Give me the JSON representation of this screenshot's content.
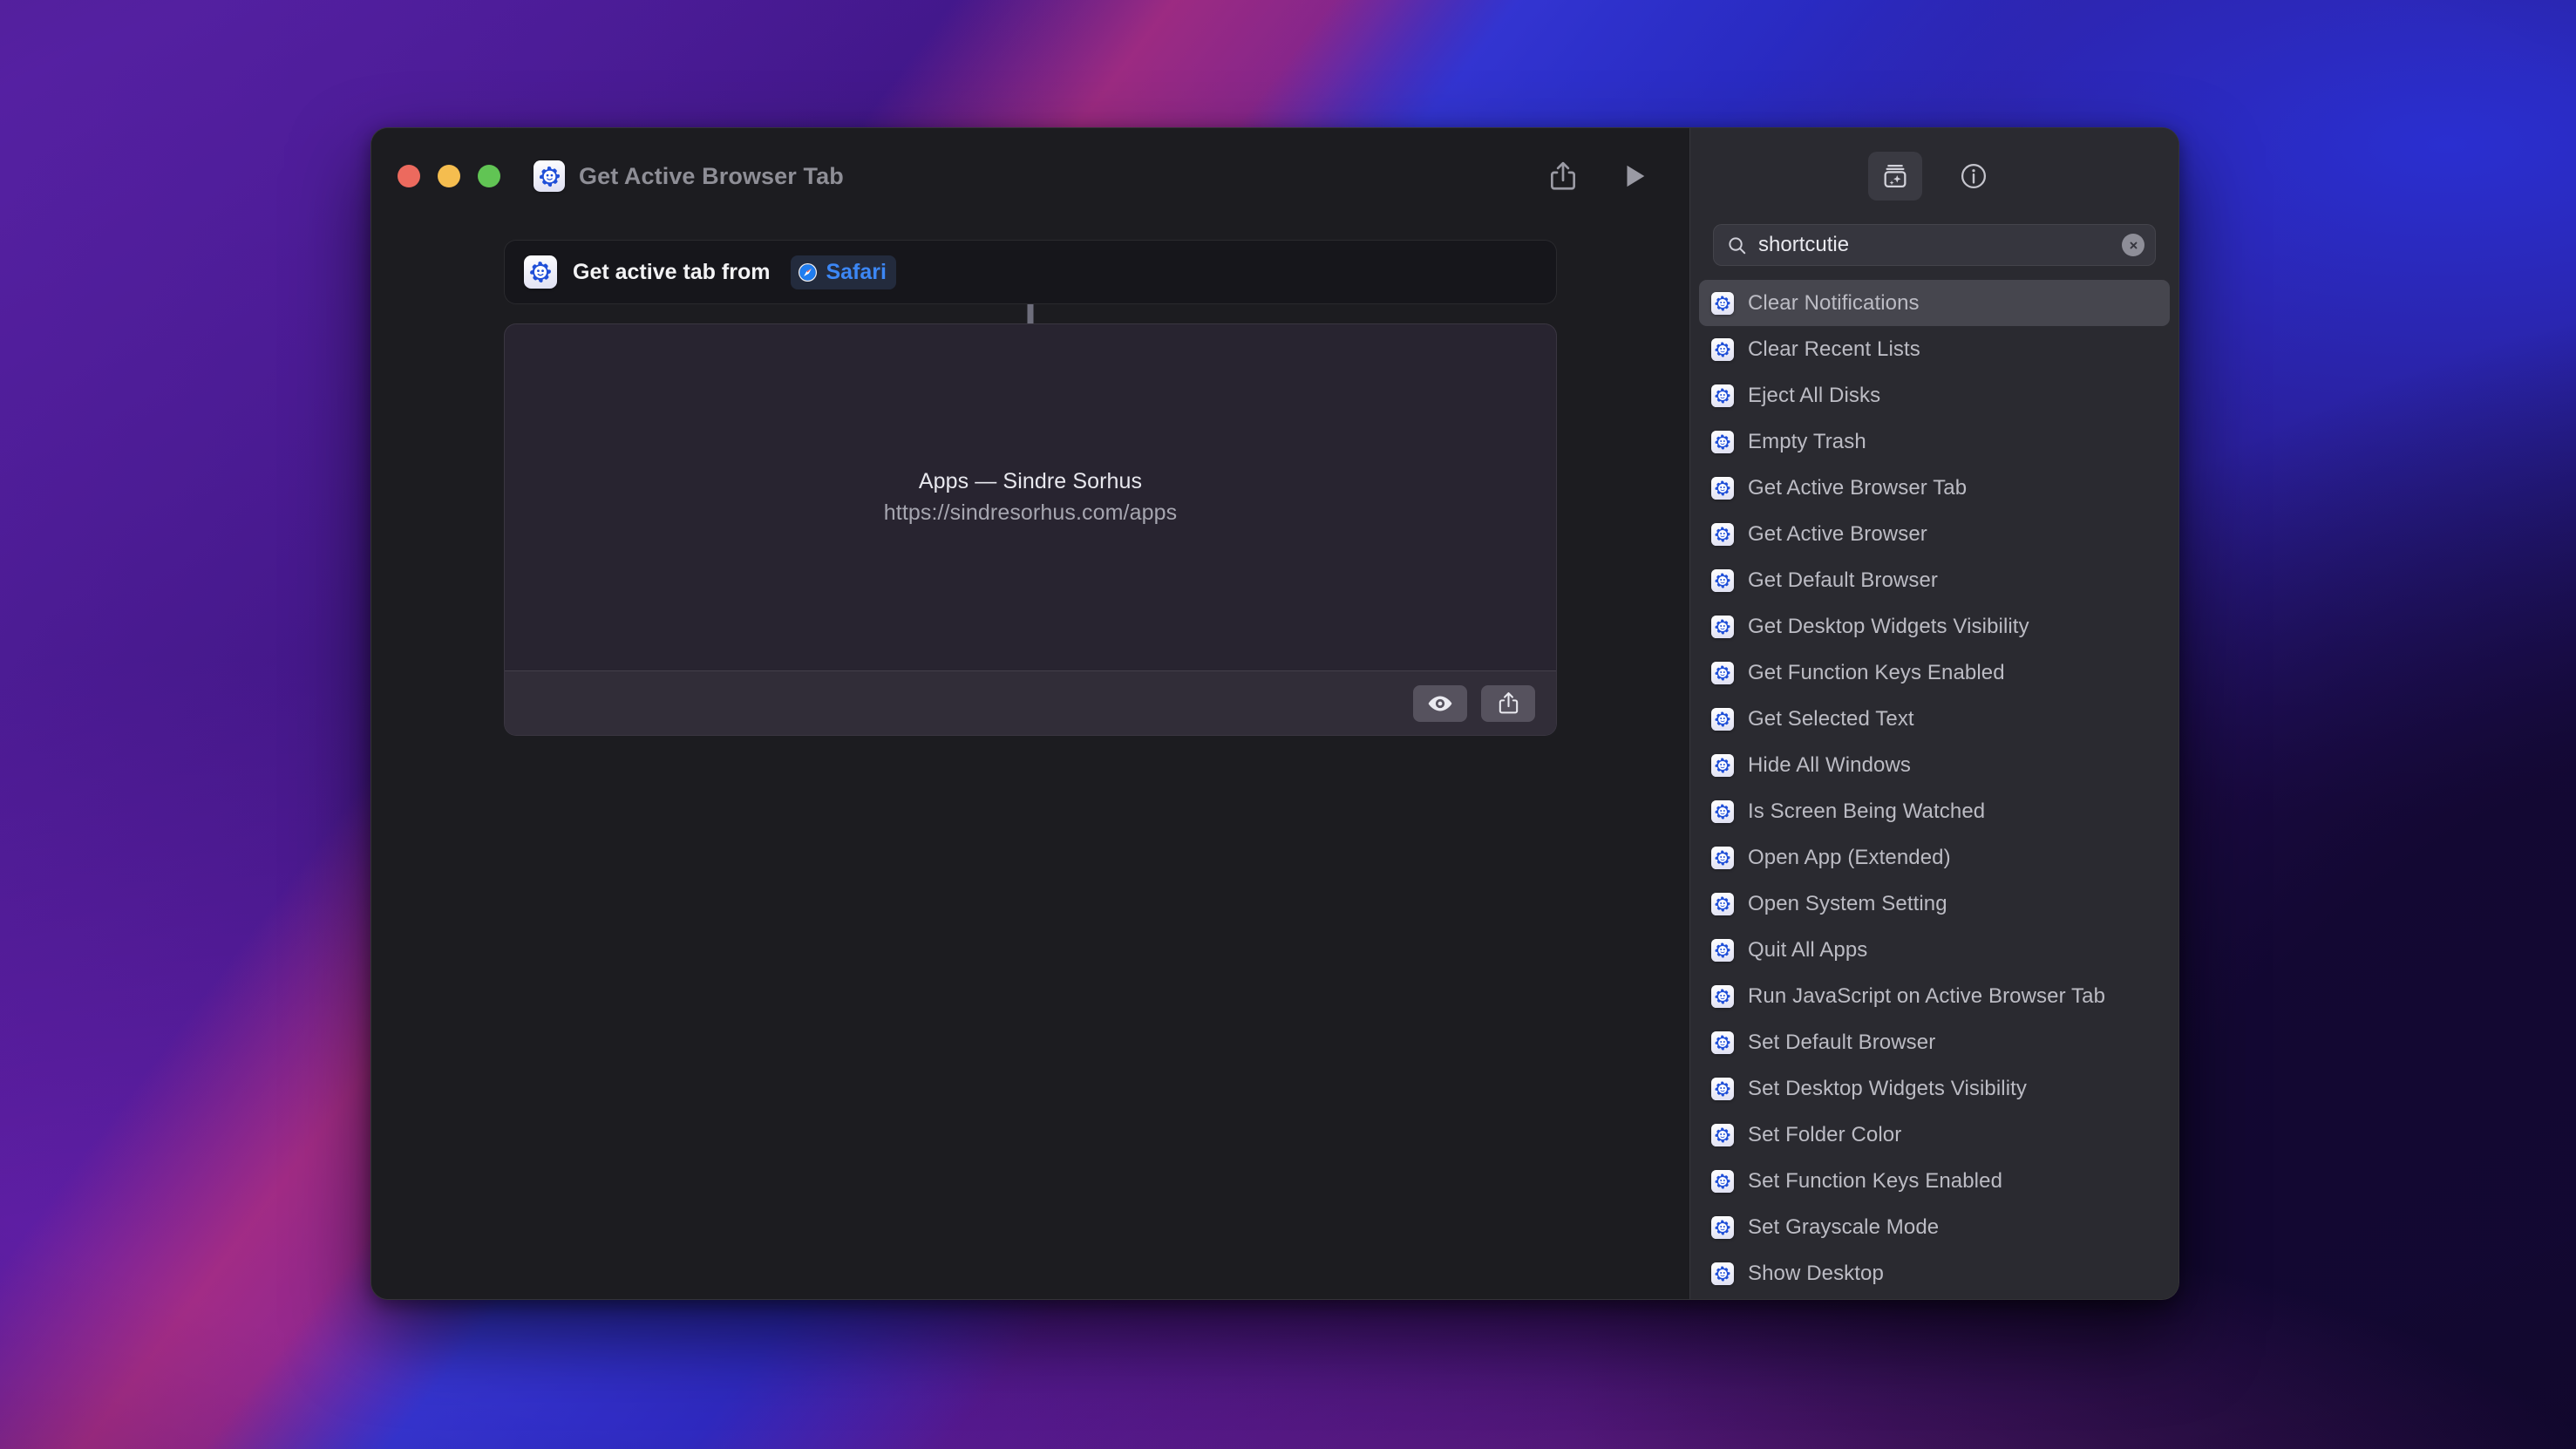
{
  "window": {
    "title": "Get Active Browser Tab",
    "app_icon": "shortcuts-gear-icon",
    "traffic_lights": {
      "close": "close-window-button",
      "minimize": "minimize-window-button",
      "maximize": "maximize-window-button",
      "close_color": "#EC6A5E",
      "minimize_color": "#F5BD4F",
      "maximize_color": "#61C454"
    },
    "toolbar": {
      "share_label": "Share",
      "run_label": "Run"
    }
  },
  "editor": {
    "action": {
      "text": "Get active tab from",
      "variable": {
        "label": "Safari",
        "icon": "safari-compass-icon",
        "color": "#3C87F5"
      }
    },
    "preview": {
      "title": "Apps — Sindre Sorhus",
      "url": "https://sindresorhus.com/apps",
      "footer": {
        "quicklook_label": "Quick Look",
        "share_label": "Share"
      }
    }
  },
  "sidebar": {
    "toolbar": {
      "library_label": "Action Library",
      "info_label": "Info"
    },
    "search": {
      "value": "shortcutie",
      "placeholder": "Search",
      "icon": "search-icon",
      "clear_label": "Clear search"
    },
    "items": [
      {
        "label": "Clear Notifications",
        "selected": true
      },
      {
        "label": "Clear Recent Lists",
        "selected": false
      },
      {
        "label": "Eject All Disks",
        "selected": false
      },
      {
        "label": "Empty Trash",
        "selected": false
      },
      {
        "label": "Get Active Browser Tab",
        "selected": false
      },
      {
        "label": "Get Active Browser",
        "selected": false
      },
      {
        "label": "Get Default Browser",
        "selected": false
      },
      {
        "label": "Get Desktop Widgets Visibility",
        "selected": false
      },
      {
        "label": "Get Function Keys Enabled",
        "selected": false
      },
      {
        "label": "Get Selected Text",
        "selected": false
      },
      {
        "label": "Hide All Windows",
        "selected": false
      },
      {
        "label": "Is Screen Being Watched",
        "selected": false
      },
      {
        "label": "Open App (Extended)",
        "selected": false
      },
      {
        "label": "Open System Setting",
        "selected": false
      },
      {
        "label": "Quit All Apps",
        "selected": false
      },
      {
        "label": "Run JavaScript on Active Browser Tab",
        "selected": false
      },
      {
        "label": "Set Default Browser",
        "selected": false
      },
      {
        "label": "Set Desktop Widgets Visibility",
        "selected": false
      },
      {
        "label": "Set Folder Color",
        "selected": false
      },
      {
        "label": "Set Function Keys Enabled",
        "selected": false
      },
      {
        "label": "Set Grayscale Mode",
        "selected": false
      },
      {
        "label": "Show Desktop",
        "selected": false
      }
    ]
  }
}
